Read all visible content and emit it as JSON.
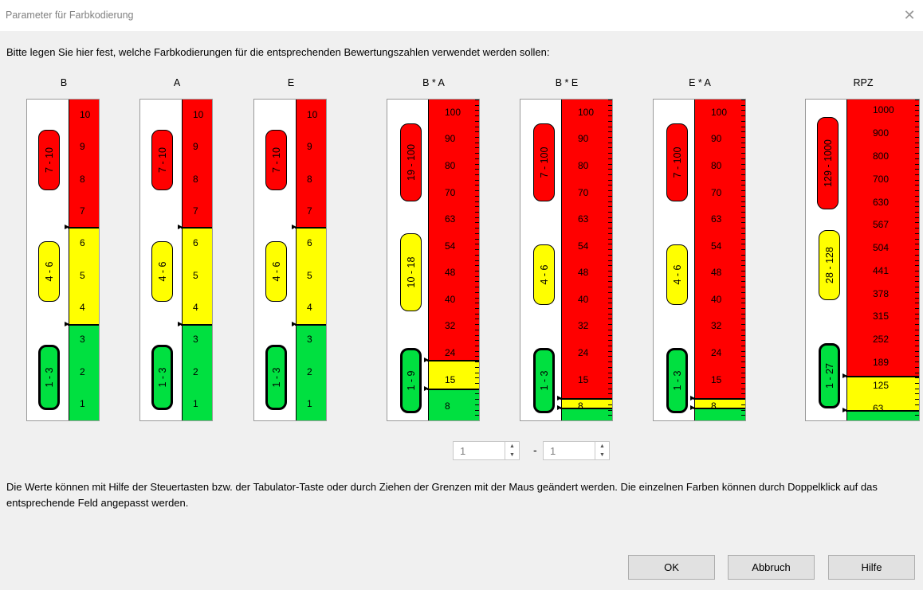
{
  "window": {
    "title": "Parameter für Farbkodierung",
    "close_glyph": "✕"
  },
  "instruction": "Bitte legen Sie hier fest, welche Farbkodierungen für die entsprechenden Bewertungszahlen verwendet werden sollen:",
  "colors": {
    "red": "#ff0000",
    "yellow": "#ffff00",
    "green": "#00e040"
  },
  "gauges": [
    {
      "id": "b",
      "header": "B",
      "ticks": [
        "10",
        "9",
        "8",
        "7",
        "6",
        "5",
        "4",
        "3",
        "2",
        "1"
      ],
      "ranges": {
        "red": "7 - 10",
        "yellow": "4 - 6",
        "green": "1 - 3"
      }
    },
    {
      "id": "a",
      "header": "A",
      "ticks": [
        "10",
        "9",
        "8",
        "7",
        "6",
        "5",
        "4",
        "3",
        "2",
        "1"
      ],
      "ranges": {
        "red": "7 - 10",
        "yellow": "4 - 6",
        "green": "1 - 3"
      }
    },
    {
      "id": "e",
      "header": "E",
      "ticks": [
        "10",
        "9",
        "8",
        "7",
        "6",
        "5",
        "4",
        "3",
        "2",
        "1"
      ],
      "ranges": {
        "red": "7 - 10",
        "yellow": "4 - 6",
        "green": "1 - 3"
      }
    },
    {
      "id": "ba",
      "header": "B * A",
      "ticks": [
        "100",
        "90",
        "80",
        "70",
        "63",
        "54",
        "48",
        "40",
        "32",
        "24",
        "15",
        "8"
      ],
      "ranges": {
        "red": "19 - 100",
        "yellow": "10 - 18",
        "green": "1 - 9"
      }
    },
    {
      "id": "be",
      "header": "B * E",
      "ticks": [
        "100",
        "90",
        "80",
        "70",
        "63",
        "54",
        "48",
        "40",
        "32",
        "24",
        "15",
        "8"
      ],
      "ranges": {
        "red": "7 - 100",
        "yellow": "4 - 6",
        "green": "1 - 3"
      }
    },
    {
      "id": "ea",
      "header": "E * A",
      "ticks": [
        "100",
        "90",
        "80",
        "70",
        "63",
        "54",
        "48",
        "40",
        "32",
        "24",
        "15",
        "8"
      ],
      "ranges": {
        "red": "7 - 100",
        "yellow": "4 - 6",
        "green": "1 - 3"
      }
    },
    {
      "id": "rpz",
      "header": "RPZ",
      "ticks": [
        "1000",
        "900",
        "800",
        "700",
        "630",
        "567",
        "504",
        "441",
        "378",
        "315",
        "252",
        "189",
        "125",
        "63"
      ],
      "ranges": {
        "red": "129 - 1000",
        "yellow": "28 - 128",
        "green": "1 - 27"
      }
    }
  ],
  "range_inputs": {
    "from_value": "1",
    "to_value": "1",
    "separator": "-",
    "up_glyph": "▲",
    "down_glyph": "▼"
  },
  "note": "Die Werte können mit Hilfe der Steuertasten bzw. der Tabulator-Taste oder durch Ziehen der Grenzen mit der Maus geändert werden. Die einzelnen Farben können durch Doppelklick auf das entsprechende Feld angepasst werden.",
  "buttons": {
    "ok": "OK",
    "cancel": "Abbruch",
    "help": "Hilfe"
  }
}
